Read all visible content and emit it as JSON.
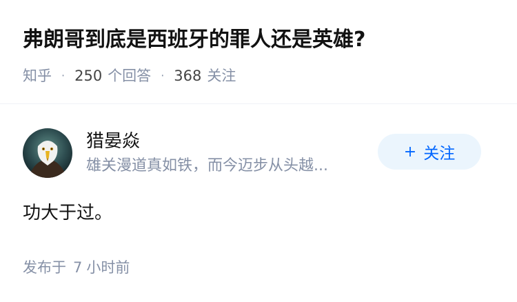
{
  "question": {
    "title": "弗朗哥到底是西班牙的罪人还是英雄?",
    "source": "知乎",
    "separator": "·",
    "answers_count": "250",
    "answers_label": "个回答",
    "followers_count": "368",
    "followers_label": "关注"
  },
  "answer": {
    "author": {
      "name": "猎晏焱",
      "headline": "雄关漫道真如铁，而今迈步从头越..."
    },
    "follow_button": {
      "plus": "+",
      "label": "关注"
    },
    "content": "功大于过。",
    "time": {
      "prefix": "发布于",
      "value": "7",
      "unit": "小时前"
    }
  },
  "colors": {
    "brand_blue": "#0066ff",
    "follow_bg": "#ebf5fd",
    "meta_gray": "#8590a6",
    "text": "#121212"
  },
  "icons": {
    "avatar": "eagle-avatar"
  }
}
